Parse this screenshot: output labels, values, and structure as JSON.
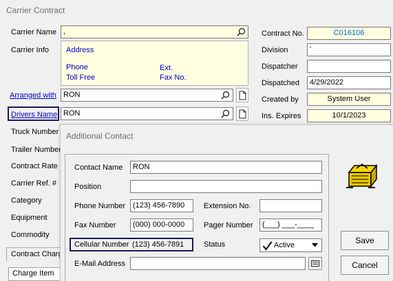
{
  "window": {
    "title": "Carrier Contract"
  },
  "form": {
    "carrier_name_label": "Carrier Name",
    "carrier_name_value": ",",
    "carrier_info_label": "Carrier Info",
    "address_label": "Address",
    "phone_label": "Phone",
    "ext_label": "Ext.",
    "toll_free_label": "Toll Free",
    "fax_no_label": "Fax No.",
    "arranged_with_label": "Arranged with",
    "arranged_with_value": "RON",
    "drivers_name_label": "Drivers Name",
    "drivers_name_value": "RON",
    "truck_number_label": "Truck Number",
    "trailer_number_label": "Trailer Number",
    "contract_rate_label": "Contract Rate",
    "carrier_ref_label": "Carrier Ref. #",
    "category_label": "Category",
    "equipment_label": "Equipment",
    "commodity_label": "Commodity",
    "contract_charges_label": "Contract Charg",
    "charge_item_label": "Charge Item",
    "contract_no_label": "Contract No.",
    "contract_no_value": "C016106",
    "division_label": "Division",
    "division_value": "'",
    "dispatcher_label": "Dispatcher",
    "dispatcher_value": "",
    "dispatched_label": "Dispatched",
    "dispatched_value": "4/29/2022",
    "created_by_label": "Created by",
    "created_by_value": "System User",
    "ins_expires_label": "Ins. Expires",
    "ins_expires_value": "10/1/2023"
  },
  "dialog": {
    "title": "Additional Contact",
    "contact_name_label": "Contact Name",
    "contact_name_value": "RON",
    "position_label": "Position",
    "position_value": "",
    "phone_number_label": "Phone Number",
    "phone_number_value": "(123) 456-7890",
    "extension_no_label": "Extension No.",
    "extension_no_value": "",
    "fax_number_label": "Fax Number",
    "fax_number_value": "(000) 000-0000",
    "pager_number_label": "Pager Number",
    "pager_number_value": "(___) ___-____",
    "cellular_number_label": "Cellular Number",
    "cellular_number_value": "(123) 456-7891",
    "status_label": "Status",
    "status_value": "Active",
    "email_label": "E-Mail Address",
    "email_value": "",
    "save_label": "Save",
    "cancel_label": "Cancel"
  },
  "icons": {
    "search": "search-icon",
    "document": "document-icon",
    "email": "email-icon",
    "dropdown": "chevron-down-icon",
    "checkmark": "checkmark-icon",
    "rolodex": "rolodex-icon"
  },
  "colors": {
    "link": "#0000cc",
    "field_yellow": "#ffffe1",
    "contract_no_text": "#0066cc",
    "highlight_border": "#1a1a4e"
  }
}
